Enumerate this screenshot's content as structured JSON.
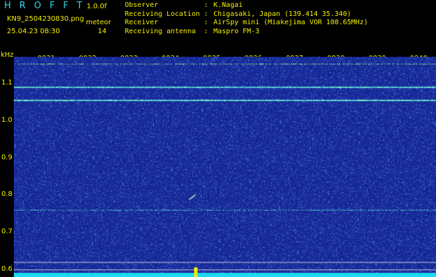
{
  "header": {
    "title": "H R O F F T",
    "version": "1.0.0f",
    "filename": "KN9_2504230830.png",
    "mode": "meteor",
    "datetime": "25.04.23 08:30",
    "count": "14"
  },
  "meta": [
    {
      "key": "Observer",
      "value": "K.Nagai"
    },
    {
      "key": "Receiving Location",
      "value": "Chigasaki, Japan (139.414 35.340)"
    },
    {
      "key": "Receiver",
      "value": "AirSpy mini (Miakejima VOR 108.65MHz)"
    },
    {
      "key": "Receiving antenna",
      "value": "Maspro FM-3"
    }
  ],
  "axis": {
    "unit": "kHz",
    "y_ticks": [
      "1.1",
      "1.0",
      "0.9",
      "0.8",
      "0.7",
      "0.6"
    ],
    "time_ticks": [
      "0831",
      "0832",
      "0833",
      "0834",
      "0835",
      "0836",
      "0837",
      "0838",
      "0839",
      "0840"
    ]
  },
  "spectrogram": {
    "freq_range_khz": [
      0.58,
      1.17
    ],
    "background": "#1a2c9c",
    "noise_color": "#4a78e6",
    "bright_color": "#6ff0ff",
    "carrier_lines_khz": [
      1.09,
      1.055,
      0.76,
      0.62,
      0.6
    ],
    "meteor_pings": [
      {
        "time": "0834.2",
        "freq_khz": 0.795
      }
    ]
  },
  "colors": {
    "label_yellow": "#f4f000",
    "title_cyan": "#31d9e8"
  }
}
